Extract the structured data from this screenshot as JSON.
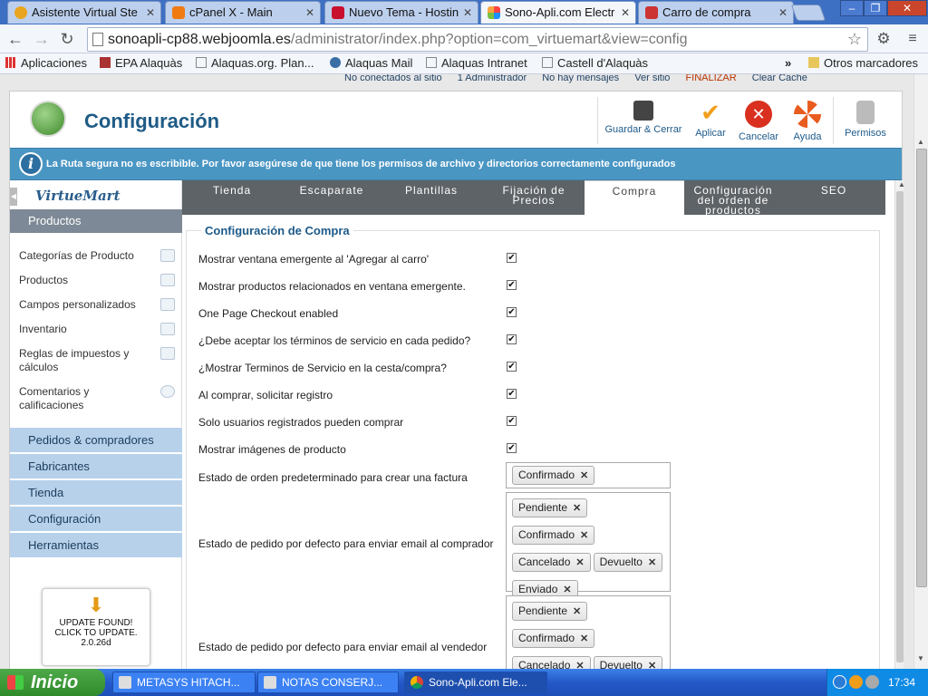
{
  "browser": {
    "tabs": [
      {
        "title": "Asistente Virtual Ste",
        "icon": "paw-icon",
        "active": false
      },
      {
        "title": "cPanel X - Main",
        "icon": "cpanel-icon",
        "active": false
      },
      {
        "title": "Nuevo Tema - Hostin",
        "icon": "hosting-icon",
        "active": false
      },
      {
        "title": "Sono-Apli.com Electr",
        "icon": "joomla-icon",
        "active": true
      },
      {
        "title": "Carro de compra",
        "icon": "cart-icon",
        "active": false
      }
    ],
    "close_glyph": "✕",
    "url_host": "sonoapli-cp88.webjoomla.es",
    "url_path": "/administrator/index.php?option=com_virtuemart&view=config",
    "bookmarks": [
      {
        "label": "Aplicaciones",
        "icon": "apps-grid-icon"
      },
      {
        "label": "EPA Alaquàs",
        "icon": "epa-icon"
      },
      {
        "label": "Alaquas.org. Plan...",
        "icon": "page-icon"
      },
      {
        "label": "Alaquas Mail",
        "icon": "mail-icon"
      },
      {
        "label": "Alaquas Intranet",
        "icon": "page-icon"
      },
      {
        "label": "Castell d'Alaquàs",
        "icon": "page-icon"
      }
    ],
    "bookmarks_overflow": "»",
    "other_bookmarks": "Otros marcadores"
  },
  "status_strip": [
    "No conectados al sitio",
    "1 Administrador",
    "No hay mensajes",
    "Ver sitio",
    "FINALIZAR",
    "Clear Cache"
  ],
  "header": {
    "title": "Configuración",
    "buttons": [
      {
        "label": "Guardar & Cerrar",
        "icon": "save-icon"
      },
      {
        "label": "Aplicar",
        "icon": "check-icon"
      },
      {
        "label": "Cancelar",
        "icon": "cancel-icon"
      },
      {
        "label": "Ayuda",
        "icon": "lifebuoy-icon"
      },
      {
        "label": "Permisos",
        "icon": "lock-icon"
      }
    ]
  },
  "notice": "La Ruta segura no es escribible. Por favor asegúrese de que tiene los permisos de archivo y directorios correctamente configurados",
  "sidebar": {
    "logo": "VirtueMart",
    "active_section": "Productos",
    "sub_items": [
      {
        "label": "Categorías de Producto",
        "icon": "categories-icon"
      },
      {
        "label": "Productos",
        "icon": "camera-icon"
      },
      {
        "label": "Campos personalizados",
        "icon": "custom-fields-icon"
      },
      {
        "label": "Inventario",
        "icon": "inventory-chart-icon"
      },
      {
        "label": "Reglas de impuestos y cálculos",
        "icon": "calculator-icon"
      },
      {
        "label": "Comentarios y calificaciones",
        "icon": "comment-icon"
      }
    ],
    "sections": [
      "Pedidos & compradores",
      "Fabricantes",
      "Tienda",
      "Configuración",
      "Herramientas"
    ],
    "update": {
      "line1": "UPDATE FOUND!",
      "line2": "CLICK TO UPDATE.",
      "version": "2.0.26d"
    }
  },
  "content_tabs": [
    {
      "label": "Tienda",
      "active": false
    },
    {
      "label": "Escaparate",
      "active": false
    },
    {
      "label": "Plantillas",
      "active": false
    },
    {
      "label": "Fijación de Precios",
      "active": false
    },
    {
      "label": "Compra",
      "active": true
    },
    {
      "label": "Configuración del orden de productos",
      "active": false
    },
    {
      "label": "SEO",
      "active": false
    }
  ],
  "form": {
    "legend": "Configuración de Compra",
    "checkbox_rows": [
      {
        "label": "Mostrar ventana emergente al 'Agregar al carro'",
        "checked": true
      },
      {
        "label": "Mostrar productos relacionados en ventana emergente.",
        "checked": true
      },
      {
        "label": "One Page Checkout enabled",
        "checked": true
      },
      {
        "label": "¿Debe aceptar los términos de servicio en cada pedido?",
        "checked": true
      },
      {
        "label": "¿Mostrar Terminos de Servicio en la cesta/compra?",
        "checked": true
      },
      {
        "label": "Al comprar, solicitar registro",
        "checked": true
      },
      {
        "label": "Solo usuarios registrados pueden comprar",
        "checked": true
      },
      {
        "label": "Mostrar imágenes de producto",
        "checked": true
      }
    ],
    "check_glyph": "✔",
    "chip_remove": "✕",
    "multi_rows": [
      {
        "label": "Estado de orden predeterminado para crear una factura",
        "values": [
          "Confirmado"
        ]
      },
      {
        "label": "Estado de pedido por defecto para enviar email al comprador",
        "values": [
          "Pendiente",
          "Confirmado",
          "Cancelado",
          "Devuelto",
          "Enviado"
        ]
      },
      {
        "label": "Estado de pedido por defecto para enviar email al vendedor",
        "values": [
          "Pendiente",
          "Confirmado",
          "Cancelado",
          "Devuelto"
        ]
      }
    ]
  },
  "taskbar": {
    "start": "Inicio",
    "tasks": [
      {
        "label": "METASYS HITACH...",
        "icon": "app-icon",
        "active": false
      },
      {
        "label": "NOTAS CONSERJ...",
        "icon": "document-icon",
        "active": false
      },
      {
        "label": "Sono-Apli.com Ele...",
        "icon": "chrome-icon",
        "active": true
      }
    ],
    "clock": "17:34"
  },
  "colors": {
    "brand_blue": "#1f5b86",
    "notice_bg": "#4a96c3",
    "sidebar_category": "#b7d1eb",
    "taskbar": "#2459c8"
  }
}
